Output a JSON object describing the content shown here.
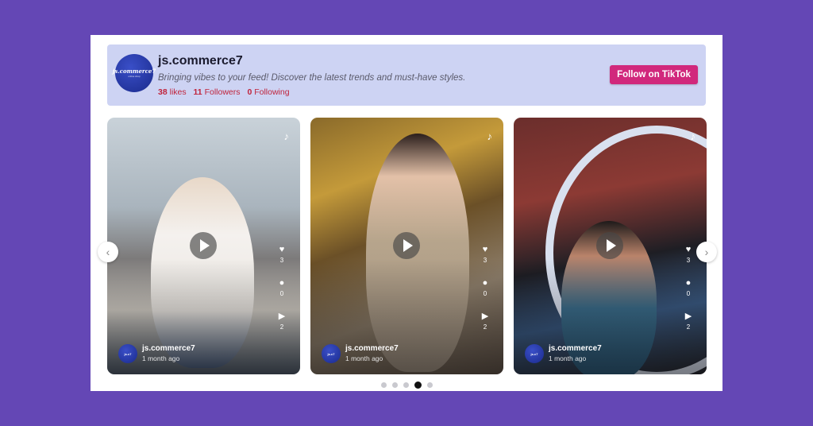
{
  "header": {
    "avatar_text": "js.commerce7",
    "avatar_subtext": "online shop",
    "account_name": "js.commerce7",
    "tagline": "Bringing vibes to your feed! Discover the latest trends and must-have styles.",
    "likes_count": "38",
    "likes_label": "likes",
    "followers_count": "11",
    "followers_label": "Followers",
    "following_count": "0",
    "following_label": "Following",
    "follow_button": "Follow on TikTok"
  },
  "cards": [
    {
      "username": "js.commerce7",
      "time": "1 month ago",
      "likes": "3",
      "comments": "0",
      "shares": "2"
    },
    {
      "username": "js.commerce7",
      "time": "1 month ago",
      "likes": "3",
      "comments": "0",
      "shares": "2"
    },
    {
      "username": "js.commerce7",
      "time": "1 month ago",
      "likes": "3",
      "comments": "0",
      "shares": "2"
    }
  ],
  "carousel": {
    "prev_icon": "chevron-left-icon",
    "next_icon": "chevron-right-icon",
    "dot_count": 5,
    "active_dot": 4
  },
  "colors": {
    "background": "#6447b5",
    "header_bg": "#cdd3f3",
    "follow_button": "#d1287c",
    "stats_accent": "#c0243c"
  }
}
